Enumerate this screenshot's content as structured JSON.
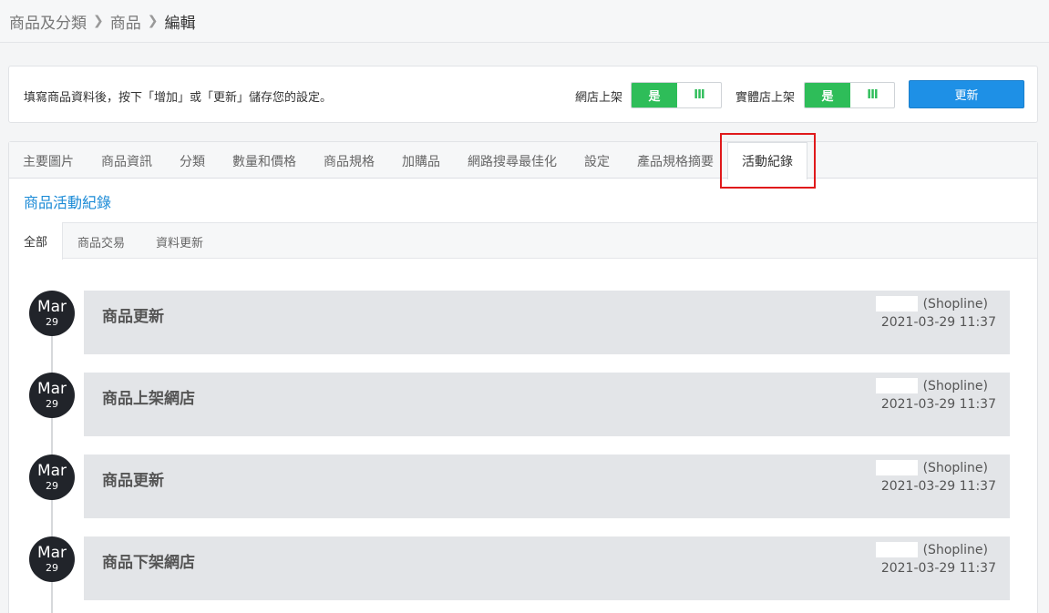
{
  "breadcrumb": {
    "items": [
      "商品及分類",
      "商品"
    ],
    "current": "編輯",
    "separator": ">"
  },
  "notice": {
    "text": "填寫商品資料後，按下「增加」或「更新」儲存您的設定。",
    "online_label": "網店上架",
    "offline_label": "實體店上架",
    "toggle_on_label": "是",
    "toggle_handle": "III",
    "update_button": "更新"
  },
  "tabs": {
    "items": [
      "主要圖片",
      "商品資訊",
      "分類",
      "數量和價格",
      "商品規格",
      "加購品",
      "網路搜尋最佳化",
      "設定",
      "產品規格摘要"
    ],
    "active": "活動紀錄"
  },
  "section": {
    "title": "商品活動紀錄",
    "subtabs_active": "全部",
    "subtabs": [
      "商品交易",
      "資料更新"
    ]
  },
  "entries": [
    {
      "month": "Mar",
      "day": "29",
      "title": "商品更新",
      "user": "(Shopline)",
      "time": "2021-03-29 11:37"
    },
    {
      "month": "Mar",
      "day": "29",
      "title": "商品上架網店",
      "user": "(Shopline)",
      "time": "2021-03-29 11:37"
    },
    {
      "month": "Mar",
      "day": "29",
      "title": "商品更新",
      "user": "(Shopline)",
      "time": "2021-03-29 11:37"
    },
    {
      "month": "Mar",
      "day": "29",
      "title": "商品下架網店",
      "user": "(Shopline)",
      "time": "2021-03-29 11:37"
    }
  ],
  "colors": {
    "accent": "#1e90e6",
    "toggle_on": "#2ebd59",
    "highlight": "#e0191b",
    "badge": "#21242a"
  }
}
